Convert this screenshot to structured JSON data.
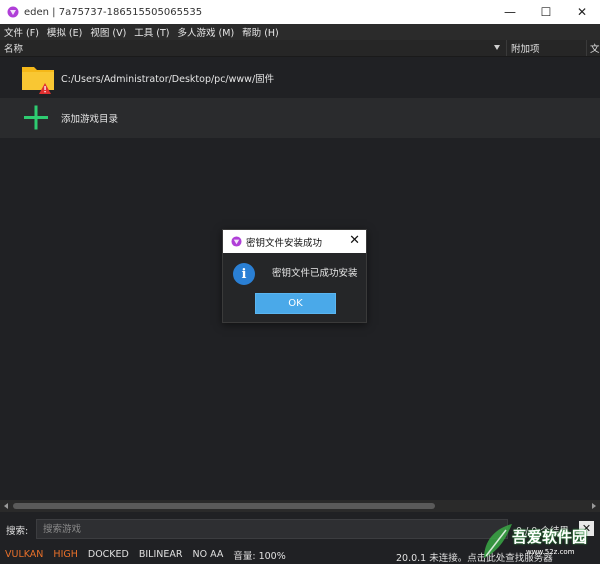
{
  "window": {
    "title": "eden | 7a75737-186515505065535",
    "minimize": "—",
    "maximize": "☐",
    "close": "✕"
  },
  "menu": {
    "items": [
      "文件 (F)",
      "模拟 (E)",
      "视图 (V)",
      "工具 (T)",
      "多人游戏 (M)",
      "帮助 (H)"
    ]
  },
  "columns": {
    "name": "名称",
    "addons": "附加项",
    "more": "文"
  },
  "list": {
    "rows": [
      {
        "label": "C:/Users/Administrator/Desktop/pc/www/固件",
        "icon": "folder-warning-icon"
      },
      {
        "label": "添加游戏目录",
        "icon": "plus-icon"
      }
    ]
  },
  "dialog": {
    "title": "密钥文件安装成功",
    "close": "✕",
    "info_glyph": "i",
    "message": "密钥文件已成功安装",
    "ok": "OK"
  },
  "search": {
    "label": "搜索:",
    "placeholder": "搜索游戏",
    "count": "0 / 0 个结果",
    "clear": "✕"
  },
  "status": {
    "vulkan": "VULKAN",
    "high": "HIGH",
    "docked": "DOCKED",
    "filter": "BILINEAR",
    "aa": "NO AA",
    "volume": "音量: 100%",
    "right": "20.0.1 未连接。点击此处查找服务器"
  },
  "watermark": {
    "text": "吾爱软件园",
    "sub": "www.52z.com"
  },
  "colors": {
    "accent_orange": "#e8702a",
    "ok_button": "#4aa9e9",
    "info_blue": "#2a7fd4",
    "folder_yellow": "#f5b819",
    "plus_green": "#2ecc71"
  }
}
